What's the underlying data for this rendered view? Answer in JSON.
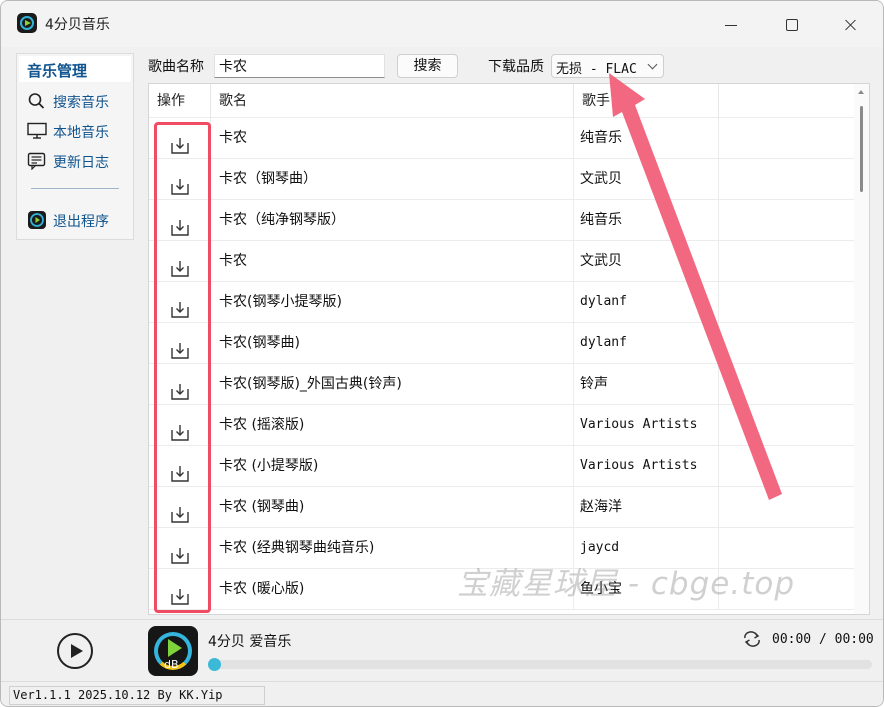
{
  "app": {
    "title": "4分贝音乐"
  },
  "sidebar": {
    "header": "音乐管理",
    "items": [
      {
        "label": "搜索音乐",
        "icon": "search-icon"
      },
      {
        "label": "本地音乐",
        "icon": "monitor-icon"
      },
      {
        "label": "更新日志",
        "icon": "log-icon"
      },
      {
        "label": "退出程序",
        "icon": "app-logo-icon"
      }
    ]
  },
  "search": {
    "label": "歌曲名称",
    "value": "卡农",
    "button": "搜索",
    "quality_label": "下载品质",
    "quality_value": "无损 - FLAC"
  },
  "table": {
    "columns": [
      "操作",
      "歌名",
      "歌手",
      ""
    ],
    "rows": [
      {
        "name": "卡农",
        "artist": "纯音乐"
      },
      {
        "name": "卡农（钢琴曲）",
        "artist": "文武贝"
      },
      {
        "name": "卡农（纯净钢琴版）",
        "artist": "纯音乐"
      },
      {
        "name": "卡农",
        "artist": "文武贝"
      },
      {
        "name": "卡农(钢琴小提琴版)",
        "artist": "dylanf"
      },
      {
        "name": "卡农(钢琴曲)",
        "artist": "dylanf"
      },
      {
        "name": "卡农(钢琴版)_外国古典(铃声)",
        "artist": "铃声"
      },
      {
        "name": "卡农 (摇滚版)",
        "artist": "Various Artists"
      },
      {
        "name": "卡农 (小提琴版)",
        "artist": "Various Artists"
      },
      {
        "name": "卡农 (钢琴曲)",
        "artist": "赵海洋"
      },
      {
        "name": "卡农 (经典钢琴曲纯音乐)",
        "artist": "jaycd"
      },
      {
        "name": "卡农 (暖心版)",
        "artist": "鱼小宝"
      }
    ]
  },
  "watermark": "宝藏星球屋 - cbge.top",
  "player": {
    "title": "4分贝  爱音乐",
    "cover_text": "dB",
    "time": "00:00 / 00:00",
    "progress": 0
  },
  "status": {
    "text": "Ver1.1.1 2025.10.12 By KK.Yip"
  },
  "colors": {
    "accent": "#10548f",
    "highlight": "#ee4d64",
    "progress_knob": "#3bb9d6"
  }
}
